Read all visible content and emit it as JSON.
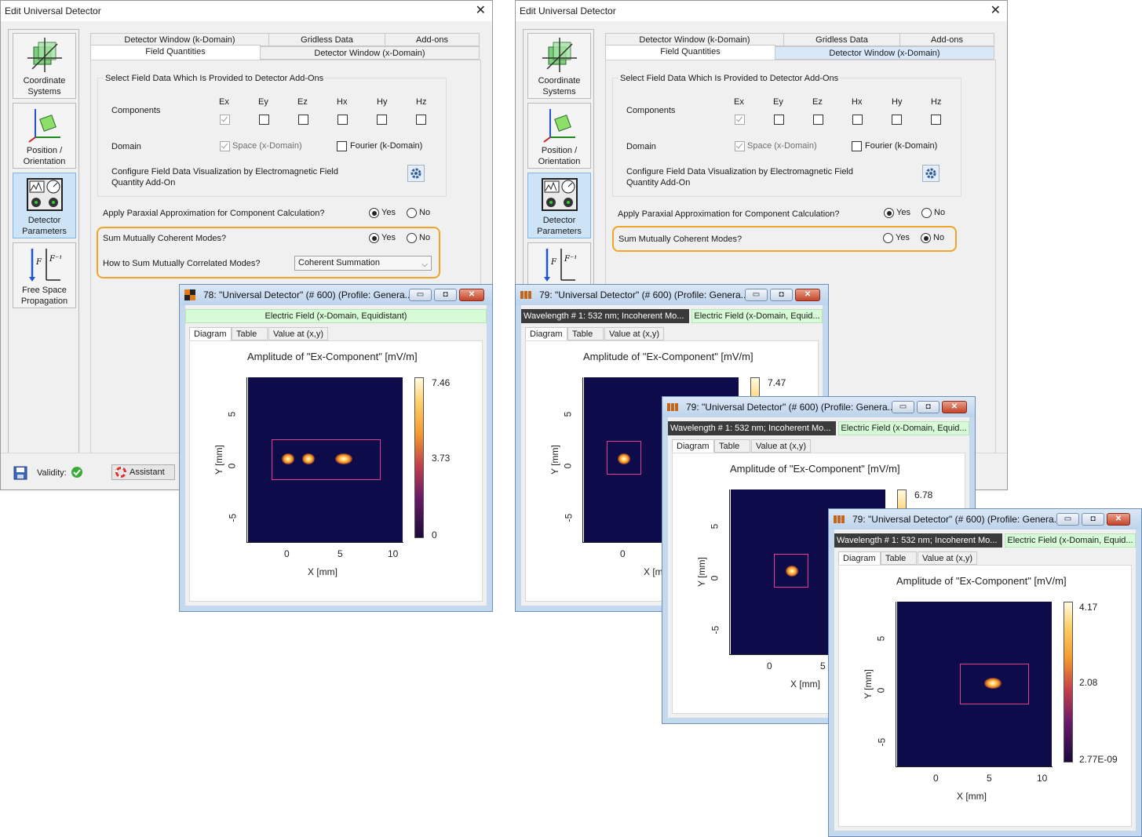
{
  "dialog": {
    "title": "Edit Universal Detector",
    "nav": [
      {
        "label": "Coordinate Systems"
      },
      {
        "label": "Position / Orientation"
      },
      {
        "label": "Detector Parameters"
      },
      {
        "label": "Free Space Propagation"
      }
    ],
    "tabs_top": [
      "Detector Window (k-Domain)",
      "Gridless Data",
      "Add-ons"
    ],
    "tabs_bottom": [
      "Field Quantities",
      "Detector Window (x-Domain)"
    ],
    "group_title": "Select Field Data Which Is Provided to Detector Add-Ons",
    "components_label": "Components",
    "components": [
      "Ex",
      "Ey",
      "Ez",
      "Hx",
      "Hy",
      "Hz"
    ],
    "domain_label": "Domain",
    "domain_space": "Space (x-Domain)",
    "domain_fourier": "Fourier (k-Domain)",
    "configure_line1": "Configure Field Data Visualization by Electromagnetic Field",
    "configure_line2": "Quantity Add-On",
    "paraxial_q": "Apply Paraxial Approximation for Component Calculation?",
    "sum_q": "Sum Mutually Coherent Modes?",
    "howto_q": "How to Sum Mutually Correlated Modes?",
    "combo_value": "Coherent Summation",
    "yes": "Yes",
    "no": "No",
    "validity": "Validity:",
    "assistant": "Assistant"
  },
  "windows": {
    "w78": {
      "title": "78: \"Universal Detector\" (# 600) (Profile: Genera...",
      "band_green": "Electric Field (x-Domain, Equidistant)",
      "tabs": [
        "Diagram",
        "Table",
        "Value at (x,y)"
      ],
      "plot_title": "Amplitude of \"Ex-Component\"  [mV/m]",
      "cbar": [
        "7.46",
        "3.73",
        "0"
      ],
      "xticks": [
        "0",
        "5",
        "10"
      ],
      "yticks": [
        "5",
        "0",
        "-5"
      ],
      "xlabel": "X [mm]",
      "ylabel": "Y [mm]"
    },
    "w79": {
      "title": "79: \"Universal Detector\" (# 600) (Profile: Genera...",
      "band_dark": "Wavelength # 1: 532 nm; Incoherent Mo...",
      "band_green": "Electric Field (x-Domain, Equid...",
      "tabs": [
        "Diagram",
        "Table",
        "Value at (x,y)"
      ],
      "plot_title": "Amplitude of \"Ex-Component\"  [mV/m]",
      "xlabel": "X [mm]",
      "ylabel": "Y [mm]",
      "xticks": [
        "0",
        "5",
        "10"
      ],
      "yticks": [
        "5",
        "0",
        "-5"
      ],
      "cbar_a": [
        "7.47"
      ],
      "cbar_b": [
        "6.78"
      ],
      "cbar_c": [
        "4.17",
        "2.08",
        "2.77E-09"
      ],
      "xlabel_cut": "X [m"
    }
  },
  "colors": {
    "highlight": "#f0a52a",
    "roi": "#e23a8c",
    "heat_bg": "#0e0b4a",
    "green_band": "#d7fbd7"
  }
}
